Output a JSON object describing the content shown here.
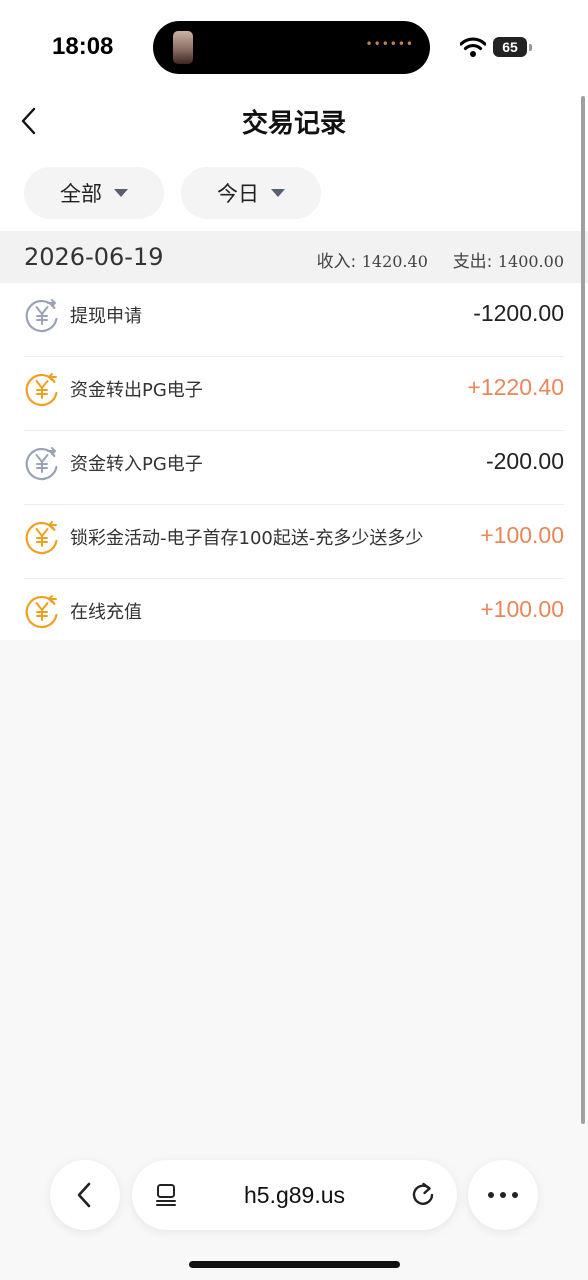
{
  "status_bar": {
    "time": "18:08",
    "battery": "65"
  },
  "header": {
    "title": "交易记录"
  },
  "filters": {
    "type": "全部",
    "date": "今日"
  },
  "date_group": {
    "date": "2026-06-19",
    "income_label": "收入:",
    "income_value": "1420.40",
    "expense_label": "支出:",
    "expense_value": "1400.00"
  },
  "transactions": [
    {
      "label": "提现申请",
      "amount": "-1200.00",
      "direction": "out",
      "icon": "yen-outgoing-icon"
    },
    {
      "label": "资金转出PG电子",
      "amount": "+1220.40",
      "direction": "in",
      "icon": "yen-incoming-icon"
    },
    {
      "label": "资金转入PG电子",
      "amount": "-200.00",
      "direction": "out",
      "icon": "yen-outgoing-icon"
    },
    {
      "label": "锁彩金活动-电子首存100起送-充多少送多少",
      "amount": "+100.00",
      "direction": "in",
      "icon": "yen-incoming-icon"
    },
    {
      "label": "在线充值",
      "amount": "+100.00",
      "direction": "in",
      "icon": "yen-incoming-icon"
    }
  ],
  "browser": {
    "url": "h5.g89.us"
  },
  "colors": {
    "income": "#e8865a",
    "expense": "#222222",
    "incoming_icon": "#f0a020",
    "outgoing_icon": "#9aa3b5"
  }
}
